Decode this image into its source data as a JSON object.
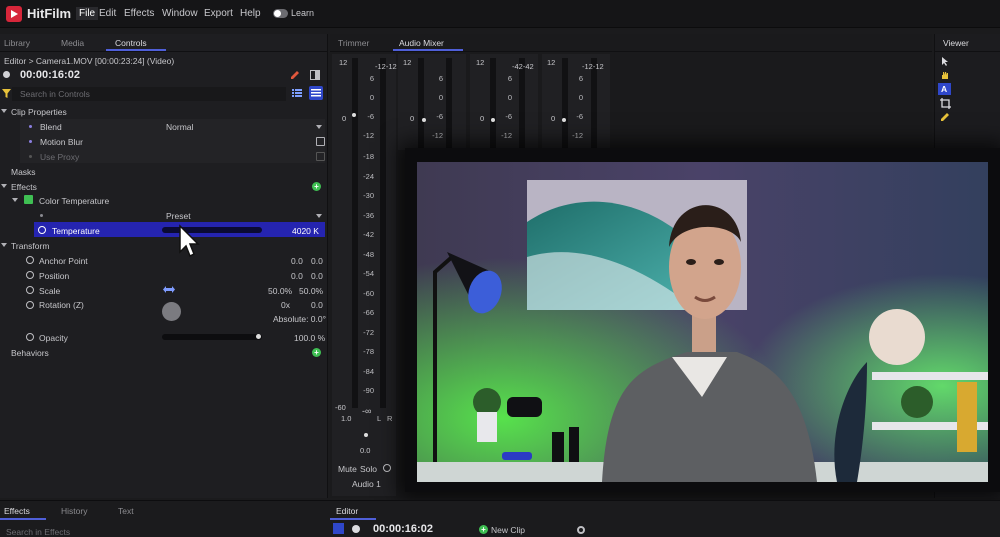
{
  "app": {
    "name": "HitFilm"
  },
  "menu": [
    "File",
    "Edit",
    "Effects",
    "Window",
    "Export",
    "Help"
  ],
  "learn_label": "Learn",
  "left_tabs": [
    "Library",
    "Media",
    "Controls"
  ],
  "breadcrumb": "Editor > Camera1.MOV [00:00:23:24] (Video)",
  "timecode": "00:00:16:02",
  "search_placeholder": "Search in Controls",
  "clip_properties": {
    "title": "Clip Properties",
    "blend_label": "Blend",
    "blend_value": "Normal",
    "motion_blur": "Motion Blur",
    "use_proxy": "Use Proxy"
  },
  "masks": "Masks",
  "effects": {
    "title": "Effects",
    "color_temp": "Color Temperature",
    "preset": "Preset",
    "temperature_label": "Temperature",
    "temperature_value": "4020 K"
  },
  "transform": {
    "title": "Transform",
    "anchor_label": "Anchor Point",
    "anchor_x": "0.0",
    "anchor_y": "0.0",
    "position_label": "Position",
    "position_x": "0.0",
    "position_y": "0.0",
    "scale_label": "Scale",
    "scale_x": "50.0%",
    "scale_y": "50.0%",
    "rotation_label": "Rotation (Z)",
    "rotation_turns": "0x",
    "rotation_deg": "0.0",
    "absolute": "Absolute: 0.0°",
    "opacity_label": "Opacity",
    "opacity_value": "100.0 %"
  },
  "behaviors": "Behaviors",
  "center_tabs": [
    "Trimmer",
    "Audio Mixer"
  ],
  "viewer_tab": "Viewer",
  "mixer": {
    "meter_top": "12",
    "meter_top_right": "-12-12",
    "meter_top_right2": "-42-42",
    "scale": [
      "6",
      "0",
      "-6",
      "-12",
      "-18",
      "-24",
      "-30",
      "-36",
      "-42",
      "-48",
      "-54",
      "-60",
      "-66",
      "-72",
      "-78",
      "-84",
      "-90"
    ],
    "scale_short": [
      "6",
      "0",
      "-6",
      "-12"
    ],
    "fader_zero": "0",
    "bottom_left": "-60",
    "volume": "1.0",
    "infinity": "-∞",
    "lr_left": "L",
    "lr_right": "R",
    "pan": "0.0",
    "mute": "Mute",
    "solo": "Solo",
    "channel_name": "Audio 1"
  },
  "bottom_tabs": [
    "Effects",
    "History",
    "Text"
  ],
  "editor_tab": "Editor",
  "editor_timecode": "00:00:16:02",
  "new_clip": "New Clip",
  "bottom_search": "Search in Effects"
}
